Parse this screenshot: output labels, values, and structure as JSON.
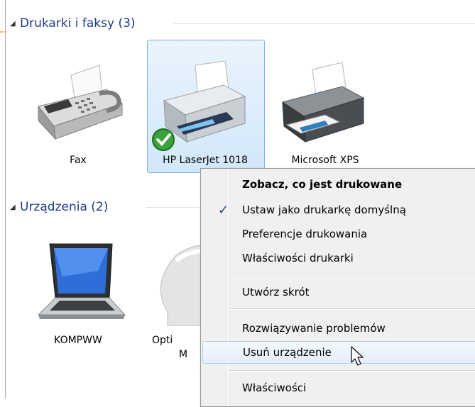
{
  "groups": {
    "printers_title": "Drukarki i faksy (3)",
    "devices_title": "Urządzenia (2)"
  },
  "printers": [
    {
      "label": "Fax",
      "icon": "fax-icon"
    },
    {
      "label": "HP LaserJet 1018",
      "icon": "printer-icon",
      "selected": true,
      "default_badge": "check-badge-icon"
    },
    {
      "label": "Microsoft XPS",
      "icon": "printer-icon"
    }
  ],
  "devices": [
    {
      "label": "KOMPWW",
      "icon": "laptop-icon"
    },
    {
      "label_line1": "Opti",
      "label_line2": "M",
      "icon": "mouse-icon"
    }
  ],
  "context_menu": {
    "items": [
      {
        "label": "Zobacz, co jest drukowane",
        "bold": true
      },
      {
        "label": "Ustaw jako drukarkę domyślną",
        "checked": true
      },
      {
        "label": "Preferencje drukowania"
      },
      {
        "label": "Właściwości drukarki"
      },
      {
        "label": "Utwórz skrót"
      },
      {
        "label": "Rozwiązywanie problemów"
      },
      {
        "label": "Usuń urządzenie",
        "hover": true
      },
      {
        "label": "Właściwości"
      }
    ],
    "check_glyph": "✓"
  },
  "colors": {
    "group_title": "#1e3c8c",
    "selection_fill": "#d2e7fa",
    "selection_border": "#7eb4ea",
    "menu_bg": "#f0f0f0"
  }
}
